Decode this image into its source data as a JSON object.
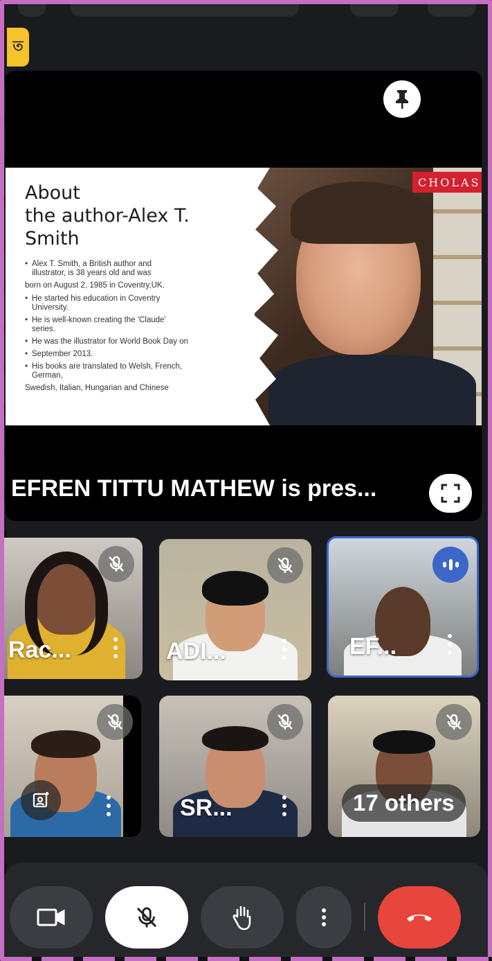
{
  "app": {
    "lang_badge": "ত"
  },
  "presentation": {
    "presenting_text": "EFREN TITTU MATHEW is pres...",
    "slide": {
      "title_lines": [
        "About",
        "the author-Alex T.",
        "Smith"
      ],
      "bullets": [
        {
          "kind": "bullet",
          "text": "Alex T. Smith, a British author and illustrator, is 38 years old and was"
        },
        {
          "kind": "para",
          "text": "born on August 2, 1985 in Coventry,UK."
        },
        {
          "kind": "bullet",
          "text": "He started his education in Coventry University."
        },
        {
          "kind": "bullet",
          "text": "He is well-known creating the 'Claude' series."
        },
        {
          "kind": "bullet",
          "text": "He was the illustrator for World Book Day on"
        },
        {
          "kind": "bullet",
          "text": "September 2013."
        },
        {
          "kind": "bullet",
          "text": "His books are translated to Welsh, French, German,"
        },
        {
          "kind": "para",
          "text": "Swedish, Italian, Hungarian and Chinese"
        }
      ],
      "shelf_sign": "CHOLAS"
    }
  },
  "participants": [
    {
      "name": "Rac...",
      "state": "muted"
    },
    {
      "name": "ADI...",
      "state": "muted"
    },
    {
      "name": "EF...",
      "state": "speaking"
    },
    {
      "name": "",
      "state": "muted"
    },
    {
      "name": "SR...",
      "state": "muted"
    },
    {
      "name": "17 others",
      "state": "muted"
    }
  ],
  "colors": {
    "accent_blue": "#3d66c9",
    "end_call_red": "#e8453c",
    "frame_pink": "#c56fc2"
  }
}
